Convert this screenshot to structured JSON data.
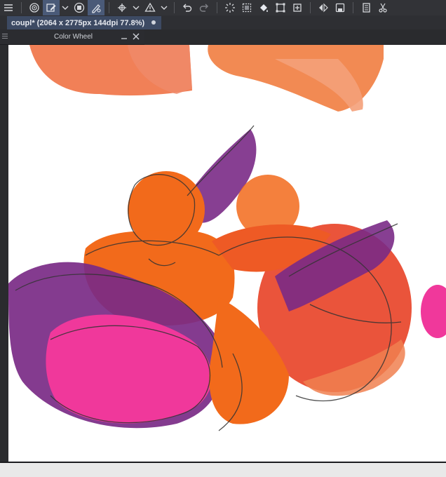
{
  "app": {
    "accent": "#3d4a63",
    "toolbar_bg": "#323337"
  },
  "toolbar": {
    "icons": [
      "hamburger-menu-icon",
      "spiral-brush-icon",
      "edit-brush-icon",
      "chevron-down-icon",
      "circle-stop-icon",
      "pen-settings-icon",
      "transform-move-icon",
      "chevron-down-icon",
      "warning-fill-icon",
      "chevron-down-icon",
      "undo-icon",
      "redo-icon",
      "sun-burst-icon",
      "dotted-selection-icon",
      "fill-bucket-icon",
      "rect-select-icon",
      "crop-icon",
      "mirror-icon",
      "save-icon",
      "layers-icon",
      "scissors-icon"
    ]
  },
  "document": {
    "tab_label": "coupl* (2064 x 2775px 144dpi 77.8%)"
  },
  "docker": {
    "title": "Color Wheel"
  },
  "canvas": {
    "colors": {
      "orange": "#f26a1b",
      "purple": "#7a2a86",
      "pink": "#f0389b",
      "red": "#e8452a"
    }
  }
}
